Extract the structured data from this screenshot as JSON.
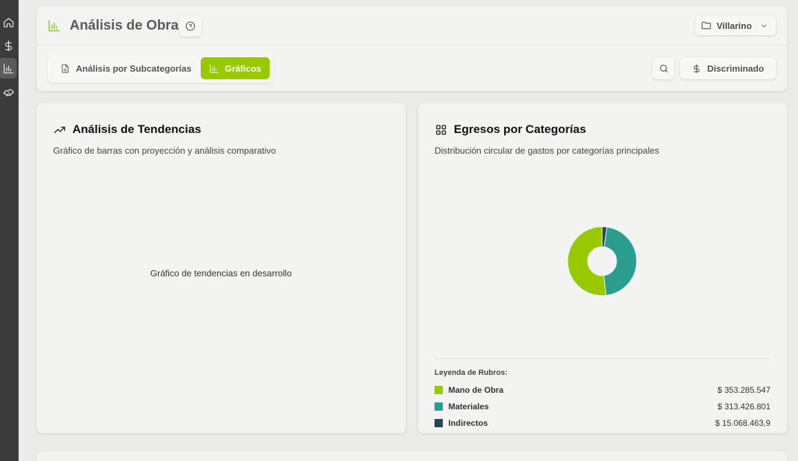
{
  "sidebar": {
    "items": [
      {
        "icon": "home-icon"
      },
      {
        "icon": "dollar-icon"
      },
      {
        "icon": "bar-chart-icon",
        "active": true
      },
      {
        "icon": "handshake-icon"
      }
    ]
  },
  "header": {
    "title": "Análisis de Obra",
    "title_icon": "bar-chart-icon",
    "help_icon": "help-circle-icon",
    "project": {
      "label": "Villarino",
      "icon": "folder-icon",
      "chevron": "chevron-down-icon"
    }
  },
  "tabs": [
    {
      "label": "Análisis por Subcategorías",
      "icon": "document-icon",
      "active": false
    },
    {
      "label": "Gráficos",
      "icon": "bar-chart-icon",
      "active": true
    }
  ],
  "toolbar": {
    "search_icon": "search-icon",
    "discriminado_label": "Discriminado",
    "discriminado_icon": "dollar-icon"
  },
  "trends_card": {
    "title": "Análisis de Tendencias",
    "icon": "trending-up-icon",
    "subtitle": "Gráfico de barras con proyección y análisis comparativo",
    "placeholder": "Gráfico de tendencias en desarrollo"
  },
  "categories_card": {
    "title": "Egresos por Categorías",
    "icon": "grid-icon",
    "subtitle": "Distribución circular de gastos por categorías principales",
    "legend_title": "Leyenda de Rubros:"
  },
  "colors": {
    "accent": "#97c800",
    "mano_de_obra": "#97c800",
    "materiales": "#2a9d8f",
    "indirectos": "#264653"
  },
  "chart_data": {
    "type": "pie",
    "donut": true,
    "title": "",
    "categories": [
      "Mano de Obra",
      "Materiales",
      "Indirectos"
    ],
    "values": [
      353285547,
      313426801,
      15068463.9
    ],
    "value_labels": [
      "$ 353.285.547",
      "$ 313.426.801",
      "$ 15.068.463,9"
    ],
    "colors": [
      "#97c800",
      "#2a9d8f",
      "#264653"
    ]
  }
}
